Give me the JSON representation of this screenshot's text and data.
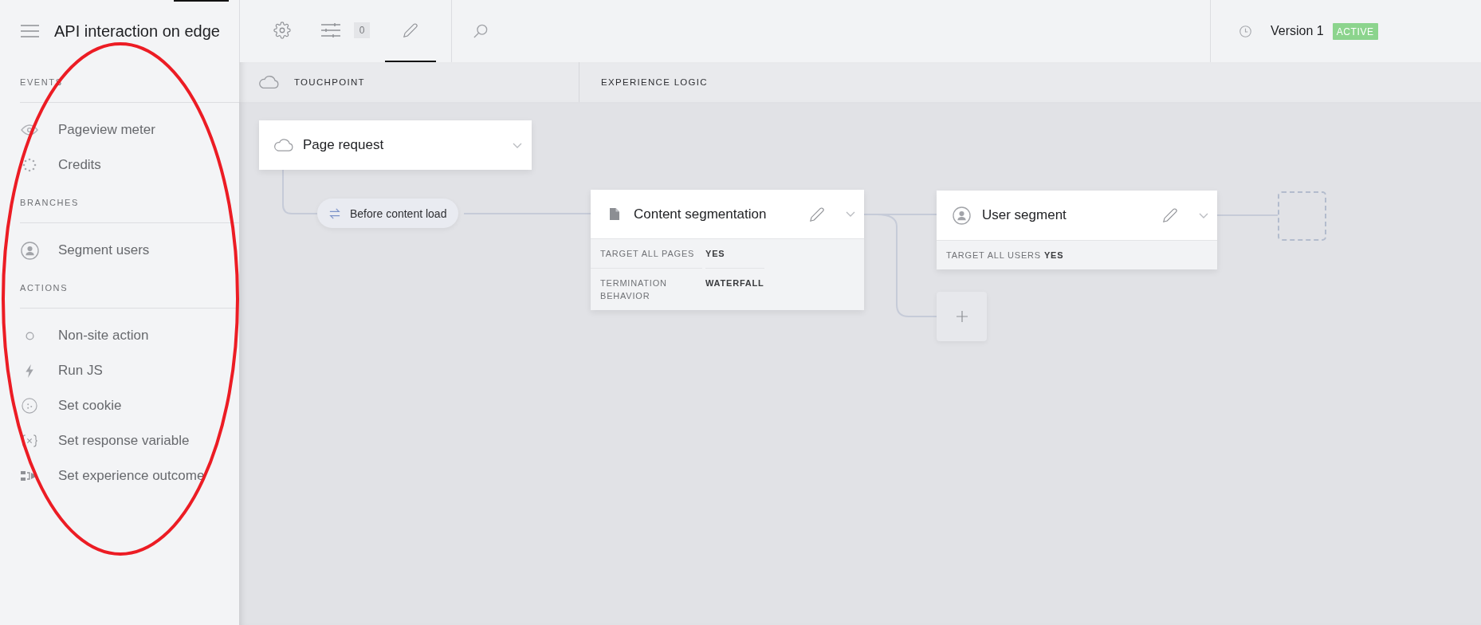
{
  "sidebar": {
    "title": "API interaction on edge",
    "sections": [
      {
        "heading": "EVENTS",
        "items": [
          {
            "label": "Pageview meter"
          },
          {
            "label": "Credits"
          }
        ]
      },
      {
        "heading": "BRANCHES",
        "items": [
          {
            "label": "Segment users"
          }
        ]
      },
      {
        "heading": "ACTIONS",
        "items": [
          {
            "label": "Non-site action"
          },
          {
            "label": "Run JS"
          },
          {
            "label": "Set cookie"
          },
          {
            "label": "Set response variable"
          },
          {
            "label": "Set experience outcome"
          }
        ]
      }
    ]
  },
  "toolbar": {
    "tabs": [
      {
        "selected": false
      },
      {
        "selected": false,
        "badge": "0"
      },
      {
        "selected": true
      }
    ]
  },
  "version": {
    "label": "Version 1",
    "status": "ACTIVE"
  },
  "lanes": [
    {
      "label": "TOUCHPOINT"
    },
    {
      "label": "EXPERIENCE LOGIC"
    }
  ],
  "flow": {
    "trigger": {
      "title": "Page request"
    },
    "event": {
      "label": "Before content load"
    },
    "nodes": [
      {
        "title": "Content segmentation",
        "properties": [
          {
            "name": "TARGET ALL PAGES",
            "value": "YES"
          },
          {
            "name": "TERMINATION BEHAVIOR",
            "value": "WATERFALL"
          }
        ]
      },
      {
        "title": "User segment",
        "properties": [
          {
            "name": "TARGET ALL USERS",
            "value": "YES"
          }
        ]
      }
    ]
  },
  "annotation": {
    "kind": "ellipse"
  }
}
